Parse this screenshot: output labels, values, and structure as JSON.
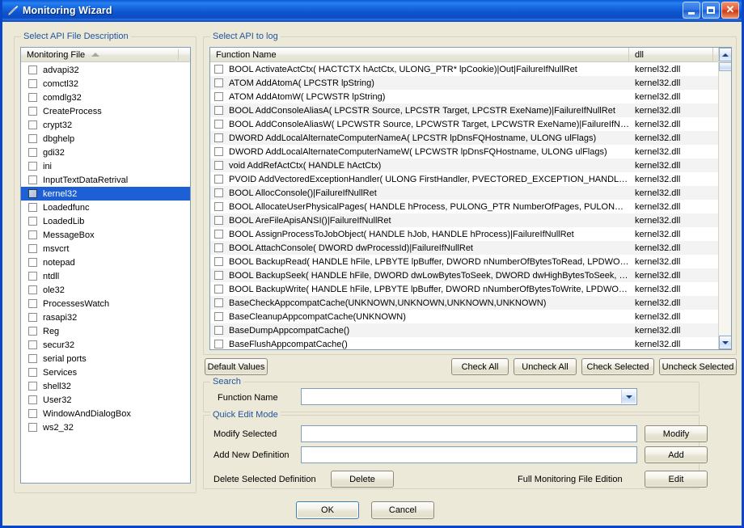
{
  "window": {
    "title": "Monitoring Wizard",
    "icon": "wand-icon",
    "minimize_label": "Minimize",
    "maximize_label": "Maximize",
    "close_label": "Close",
    "accent_color": "#0a46c8",
    "face_color": "#ece9d8",
    "selection_color": "#1d5fd4",
    "group_title_color": "#21549c"
  },
  "left_panel": {
    "group_title": "Select API File Description",
    "column_header": "Monitoring File",
    "sort_direction": "ascending",
    "selected": "kernel32",
    "items": [
      {
        "label": "advapi32",
        "checked": false
      },
      {
        "label": "comctl32",
        "checked": false
      },
      {
        "label": "comdlg32",
        "checked": false
      },
      {
        "label": "CreateProcess",
        "checked": false
      },
      {
        "label": "crypt32",
        "checked": false
      },
      {
        "label": "dbghelp",
        "checked": false
      },
      {
        "label": "gdi32",
        "checked": false
      },
      {
        "label": "ini",
        "checked": false
      },
      {
        "label": "InputTextDataRetrival",
        "checked": false
      },
      {
        "label": "kernel32",
        "checked": false
      },
      {
        "label": "Loadedfunc",
        "checked": false
      },
      {
        "label": "LoadedLib",
        "checked": false
      },
      {
        "label": "MessageBox",
        "checked": false
      },
      {
        "label": "msvcrt",
        "checked": false
      },
      {
        "label": "notepad",
        "checked": false
      },
      {
        "label": "ntdll",
        "checked": false
      },
      {
        "label": "ole32",
        "checked": false
      },
      {
        "label": "ProcessesWatch",
        "checked": false
      },
      {
        "label": "rasapi32",
        "checked": false
      },
      {
        "label": "Reg",
        "checked": false
      },
      {
        "label": "secur32",
        "checked": false
      },
      {
        "label": "serial ports",
        "checked": false
      },
      {
        "label": "Services",
        "checked": false
      },
      {
        "label": "shell32",
        "checked": false
      },
      {
        "label": "User32",
        "checked": false
      },
      {
        "label": "WindowAndDialogBox",
        "checked": false
      },
      {
        "label": "ws2_32",
        "checked": false
      }
    ]
  },
  "right_panel": {
    "group_title": "Select API to log",
    "columns": [
      "Function Name",
      "dll"
    ],
    "rows": [
      {
        "name": "BOOL ActivateActCtx( HACTCTX hActCtx, ULONG_PTR* lpCookie)|Out|FailureIfNullRet",
        "dll": "kernel32.dll",
        "checked": false
      },
      {
        "name": "ATOM AddAtomA( LPCSTR  lpString)",
        "dll": "kernel32.dll",
        "checked": false
      },
      {
        "name": "ATOM AddAtomW( LPCWSTR lpString)",
        "dll": "kernel32.dll",
        "checked": false
      },
      {
        "name": "BOOL AddConsoleAliasA( LPCSTR  Source, LPCSTR  Target, LPCSTR  ExeName)|FailureIfNullRet",
        "dll": "kernel32.dll",
        "checked": false
      },
      {
        "name": "BOOL AddConsoleAliasW( LPCWSTR Source, LPCWSTR Target, LPCWSTR ExeName)|FailureIfNullRet",
        "dll": "kernel32.dll",
        "checked": false
      },
      {
        "name": "DWORD AddLocalAlternateComputerNameA( LPCSTR  lpDnsFQHostname, ULONG ulFlags)",
        "dll": "kernel32.dll",
        "checked": false
      },
      {
        "name": "DWORD AddLocalAlternateComputerNameW( LPCWSTR lpDnsFQHostname, ULONG ulFlags)",
        "dll": "kernel32.dll",
        "checked": false
      },
      {
        "name": "void AddRefActCtx( HANDLE hActCtx)",
        "dll": "kernel32.dll",
        "checked": false
      },
      {
        "name": "PVOID AddVectoredExceptionHandler( ULONG FirstHandler, PVECTORED_EXCEPTION_HANDLER Ve...",
        "dll": "kernel32.dll",
        "checked": false
      },
      {
        "name": "BOOL AllocConsole()|FailureIfNullRet",
        "dll": "kernel32.dll",
        "checked": false
      },
      {
        "name": "BOOL AllocateUserPhysicalPages( HANDLE hProcess, PULONG_PTR NumberOfPages, PULONG_PTR ...",
        "dll": "kernel32.dll",
        "checked": false
      },
      {
        "name": "BOOL AreFileApisANSI()|FailureIfNullRet",
        "dll": "kernel32.dll",
        "checked": false
      },
      {
        "name": "BOOL AssignProcessToJobObject( HANDLE hJob, HANDLE hProcess)|FailureIfNullRet",
        "dll": "kernel32.dll",
        "checked": false
      },
      {
        "name": "BOOL AttachConsole( DWORD dwProcessId)|FailureIfNullRet",
        "dll": "kernel32.dll",
        "checked": false
      },
      {
        "name": "BOOL BackupRead( HANDLE hFile, LPBYTE lpBuffer, DWORD nNumberOfBytesToRead, LPDWORD lp...",
        "dll": "kernel32.dll",
        "checked": false
      },
      {
        "name": "BOOL BackupSeek( HANDLE hFile, DWORD dwLowBytesToSeek, DWORD dwHighBytesToSeek, LPD...",
        "dll": "kernel32.dll",
        "checked": false
      },
      {
        "name": "BOOL BackupWrite( HANDLE hFile, LPBYTE lpBuffer, DWORD nNumberOfBytesToWrite, LPDWORD lp...",
        "dll": "kernel32.dll",
        "checked": false
      },
      {
        "name": "BaseCheckAppcompatCache(UNKNOWN,UNKNOWN,UNKNOWN,UNKNOWN)",
        "dll": "kernel32.dll",
        "checked": false
      },
      {
        "name": "BaseCleanupAppcompatCache(UNKNOWN)",
        "dll": "kernel32.dll",
        "checked": false
      },
      {
        "name": "BaseDumpAppcompatCache()",
        "dll": "kernel32.dll",
        "checked": false
      },
      {
        "name": "BaseFlushAppcompatCache()",
        "dll": "kernel32.dll",
        "checked": false
      }
    ]
  },
  "toolbar": {
    "default_values": "Default Values",
    "check_all": "Check All",
    "uncheck_all": "Uncheck All",
    "check_selected": "Check Selected",
    "uncheck_selected": "Uncheck Selected"
  },
  "search": {
    "group_title": "Search",
    "function_name_label": "Function Name",
    "function_name_value": "",
    "function_name_placeholder": ""
  },
  "quick_edit": {
    "group_title": "Quick Edit Mode",
    "modify_selected_label": "Modify Selected",
    "modify_selected_value": "",
    "modify_button": "Modify",
    "add_new_definition_label": "Add New Definition",
    "add_new_definition_value": "",
    "add_button": "Add",
    "delete_selected_label": "Delete Selected Definition",
    "delete_button": "Delete",
    "full_edition_label": "Full Monitoring File Edition",
    "edit_button": "Edit"
  },
  "footer": {
    "ok": "OK",
    "cancel": "Cancel"
  }
}
